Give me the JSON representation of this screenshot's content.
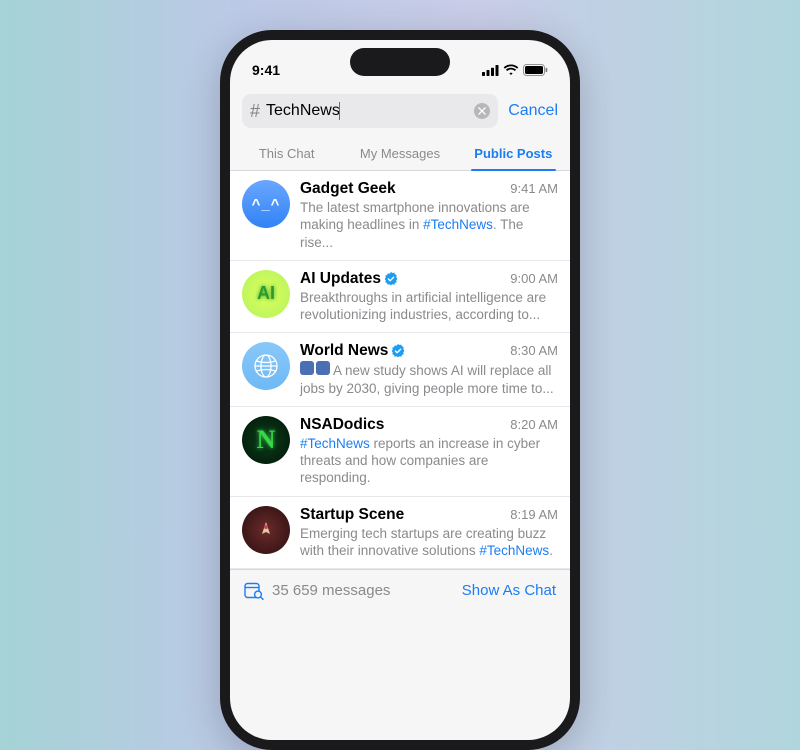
{
  "status": {
    "time": "9:41"
  },
  "search": {
    "prefix": "#",
    "text": "TechNews",
    "cancel": "Cancel"
  },
  "tabs": [
    {
      "label": "This Chat",
      "active": false
    },
    {
      "label": "My Messages",
      "active": false
    },
    {
      "label": "Public Posts",
      "active": true
    }
  ],
  "results": [
    {
      "title": "Gadget Geek",
      "time": "9:41 AM",
      "verified": false,
      "snippet_pre": "The latest smartphone innovations are making headlines in ",
      "snippet_tag": "#TechNews",
      "snippet_post": ". The rise...",
      "avatar": {
        "bg": "linear-gradient(#6aa7ff,#3182f6)",
        "face": "^_^"
      }
    },
    {
      "title": "AI Updates",
      "time": "9:00 AM",
      "verified": true,
      "snippet_pre": "Breakthroughs in artificial intelligence are revolutionizing industries, according to...",
      "snippet_tag": "",
      "snippet_post": "",
      "avatar": {
        "bg": "radial-gradient(circle,#d9ff5e,#b6f25c)",
        "label": "AI",
        "label_color": "#2c9b2c"
      }
    },
    {
      "title": "World News",
      "time": "8:30 AM",
      "verified": true,
      "snippet_thumbs": true,
      "snippet_pre": "A new study shows AI will replace all jobs by 2030, giving people more time to...",
      "snippet_tag": "",
      "snippet_post": "",
      "avatar": {
        "bg": "linear-gradient(#88c8f8,#6fb9f5)",
        "globe": true
      }
    },
    {
      "title": "NSADodics",
      "time": "8:20 AM",
      "verified": false,
      "snippet_pre": "",
      "snippet_tag": "#TechNews",
      "snippet_post": " reports an increase in cyber threats and how companies are responding.",
      "avatar": {
        "bg": "radial-gradient(circle,#0a3d1a,#031508)",
        "label": "N",
        "label_color": "#38d648",
        "serif": true
      }
    },
    {
      "title": "Startup Scene",
      "time": "8:19 AM",
      "verified": false,
      "snippet_pre": "Emerging tech startups are creating buzz with their innovative solutions ",
      "snippet_tag": "#TechNews",
      "snippet_post": ".",
      "avatar": {
        "bg": "radial-gradient(circle,#6b2a2a,#2a0f0f)",
        "rocket": true
      }
    }
  ],
  "footer": {
    "count": "35 659 messages",
    "action": "Show As Chat"
  }
}
